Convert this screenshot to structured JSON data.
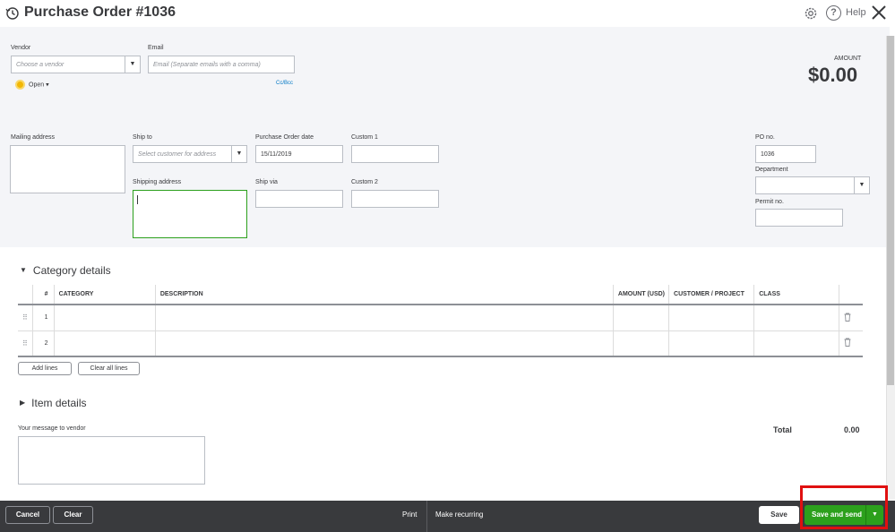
{
  "header": {
    "title": "Purchase Order #1036",
    "help_label": "Help"
  },
  "form": {
    "vendor": {
      "label": "Vendor",
      "placeholder": "Choose a vendor"
    },
    "email": {
      "label": "Email",
      "placeholder": "Email (Separate emails with a comma)",
      "cc_bcc": "Cc/Bcc"
    },
    "status": "Open",
    "amount": {
      "label": "AMOUNT",
      "value": "$0.00"
    },
    "mailing_address": {
      "label": "Mailing address"
    },
    "ship_to": {
      "label": "Ship to",
      "placeholder": "Select customer for address"
    },
    "shipping_address": {
      "label": "Shipping address"
    },
    "po_date": {
      "label": "Purchase Order date",
      "value": "15/11/2019"
    },
    "ship_via": {
      "label": "Ship via"
    },
    "custom1": {
      "label": "Custom 1"
    },
    "custom2": {
      "label": "Custom 2"
    },
    "po_no": {
      "label": "PO no.",
      "value": "1036"
    },
    "department": {
      "label": "Department"
    },
    "permit_no": {
      "label": "Permit no."
    }
  },
  "category_details": {
    "title": "Category details",
    "columns": [
      "#",
      "CATEGORY",
      "DESCRIPTION",
      "AMOUNT (USD)",
      "CUSTOMER / PROJECT",
      "CLASS"
    ],
    "rows": [
      {
        "num": "1"
      },
      {
        "num": "2"
      }
    ],
    "add_lines": "Add lines",
    "clear_all_lines": "Clear all lines"
  },
  "item_details": {
    "title": "Item details"
  },
  "message": {
    "label": "Your message to vendor"
  },
  "total": {
    "label": "Total",
    "value": "0.00"
  },
  "footer": {
    "cancel": "Cancel",
    "clear": "Clear",
    "print": "Print",
    "make_recurring": "Make recurring",
    "save": "Save",
    "save_and_send": "Save and send"
  },
  "colors": {
    "accent_green": "#2ca01c",
    "highlight_red": "#e01010",
    "footer_bg": "#393a3d"
  }
}
